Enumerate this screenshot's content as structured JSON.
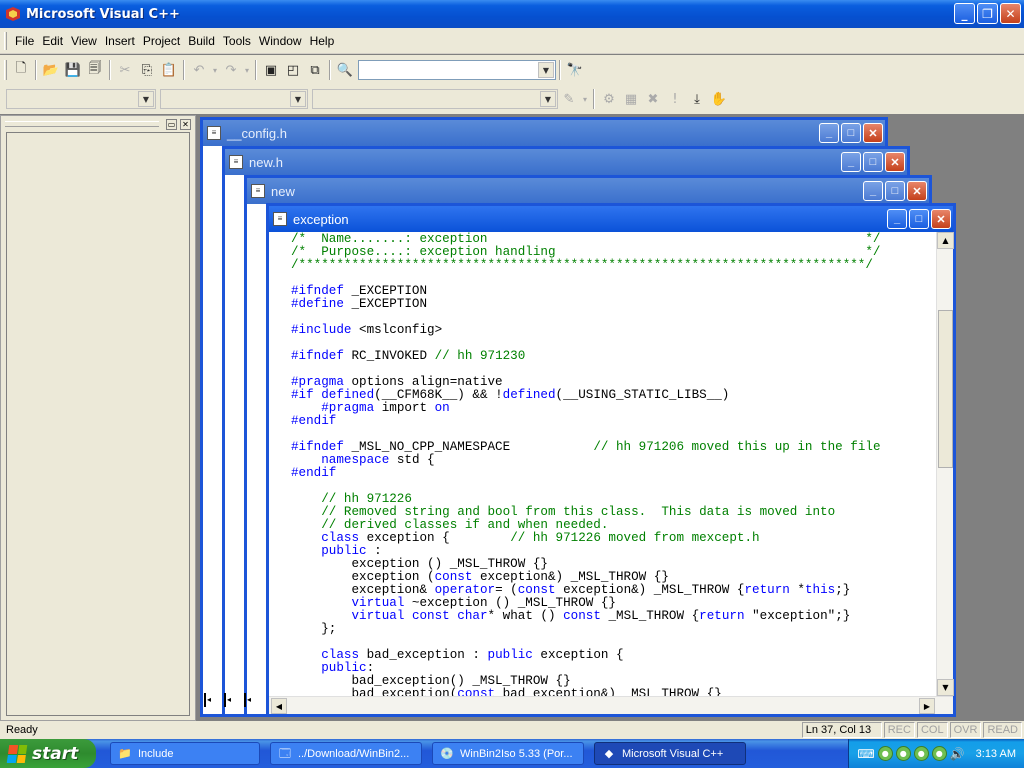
{
  "app": {
    "title": "Microsoft Visual C++"
  },
  "menu": [
    "File",
    "Edit",
    "View",
    "Insert",
    "Project",
    "Build",
    "Tools",
    "Window",
    "Help"
  ],
  "windows": [
    {
      "title": "__config.h"
    },
    {
      "title": "new.h"
    },
    {
      "title": "new"
    },
    {
      "title": "exception"
    }
  ],
  "code": [
    [
      [
        "cm",
        "/*  Name.......: exception                                                  */"
      ]
    ],
    [
      [
        "cm",
        "/*  Purpose....: exception handling                                         */"
      ]
    ],
    [
      [
        "cm",
        "/***************************************************************************/"
      ]
    ],
    [
      [
        "",
        ""
      ]
    ],
    [
      [
        "kw",
        "#ifndef"
      ],
      [
        "",
        " _EXCEPTION"
      ]
    ],
    [
      [
        "kw",
        "#define"
      ],
      [
        "",
        " _EXCEPTION"
      ]
    ],
    [
      [
        "",
        ""
      ]
    ],
    [
      [
        "kw",
        "#include"
      ],
      [
        "",
        " <mslconfig>"
      ]
    ],
    [
      [
        "",
        ""
      ]
    ],
    [
      [
        "kw",
        "#ifndef"
      ],
      [
        "",
        " RC_INVOKED "
      ],
      [
        "cm",
        "// hh 971230"
      ]
    ],
    [
      [
        "",
        ""
      ]
    ],
    [
      [
        "kw",
        "#pragma"
      ],
      [
        "",
        " options align=native"
      ]
    ],
    [
      [
        "kw",
        "#if"
      ],
      [
        "",
        " "
      ],
      [
        "kw",
        "defined"
      ],
      [
        "",
        "(__CFM68K__) && !"
      ],
      [
        "kw",
        "defined"
      ],
      [
        "",
        "(__USING_STATIC_LIBS__)"
      ]
    ],
    [
      [
        "",
        "    "
      ],
      [
        "kw",
        "#pragma"
      ],
      [
        "",
        " import "
      ],
      [
        "kw",
        "on"
      ]
    ],
    [
      [
        "kw",
        "#endif"
      ]
    ],
    [
      [
        "",
        ""
      ]
    ],
    [
      [
        "kw",
        "#ifndef"
      ],
      [
        "",
        " _MSL_NO_CPP_NAMESPACE           "
      ],
      [
        "cm",
        "// hh 971206 moved this up in the file"
      ]
    ],
    [
      [
        "",
        "    "
      ],
      [
        "kw",
        "namespace"
      ],
      [
        "",
        " std {"
      ]
    ],
    [
      [
        "kw",
        "#endif"
      ]
    ],
    [
      [
        "",
        ""
      ]
    ],
    [
      [
        "",
        "    "
      ],
      [
        "cm",
        "// hh 971226"
      ]
    ],
    [
      [
        "",
        "    "
      ],
      [
        "cm",
        "// Removed string and bool from this class.  This data is moved into"
      ]
    ],
    [
      [
        "",
        "    "
      ],
      [
        "cm",
        "// derived classes if and when needed."
      ]
    ],
    [
      [
        "",
        "    "
      ],
      [
        "kw",
        "class"
      ],
      [
        "",
        " exception {        "
      ],
      [
        "cm",
        "// hh 971226 moved from mexcept.h"
      ]
    ],
    [
      [
        "",
        "    "
      ],
      [
        "kw",
        "public"
      ],
      [
        "",
        " :"
      ]
    ],
    [
      [
        "",
        "        exception () _MSL_THROW {}"
      ]
    ],
    [
      [
        "",
        "        exception ("
      ],
      [
        "kw",
        "const"
      ],
      [
        "",
        " exception&) _MSL_THROW {}"
      ]
    ],
    [
      [
        "",
        "        exception& "
      ],
      [
        "kw",
        "operator"
      ],
      [
        "",
        "= ("
      ],
      [
        "kw",
        "const"
      ],
      [
        "",
        " exception&) _MSL_THROW {"
      ],
      [
        "kw",
        "return"
      ],
      [
        "",
        " *"
      ],
      [
        "kw",
        "this"
      ],
      [
        "",
        ";}"
      ]
    ],
    [
      [
        "",
        "        "
      ],
      [
        "kw",
        "virtual"
      ],
      [
        "",
        " ~exception () _MSL_THROW {}"
      ]
    ],
    [
      [
        "",
        "        "
      ],
      [
        "kw",
        "virtual"
      ],
      [
        "",
        " "
      ],
      [
        "kw",
        "const"
      ],
      [
        "",
        " "
      ],
      [
        "kw",
        "char"
      ],
      [
        "",
        "* what () "
      ],
      [
        "kw",
        "const"
      ],
      [
        "",
        " _MSL_THROW {"
      ],
      [
        "kw",
        "return"
      ],
      [
        "",
        " \"exception\";}"
      ]
    ],
    [
      [
        "",
        "    };"
      ]
    ],
    [
      [
        "",
        ""
      ]
    ],
    [
      [
        "",
        "    "
      ],
      [
        "kw",
        "class"
      ],
      [
        "",
        " bad_exception : "
      ],
      [
        "kw",
        "public"
      ],
      [
        "",
        " exception {"
      ]
    ],
    [
      [
        "",
        "    "
      ],
      [
        "kw",
        "public"
      ],
      [
        "",
        ":"
      ]
    ],
    [
      [
        "",
        "        bad_exception() _MSL_THROW {}"
      ]
    ],
    [
      [
        "",
        "        bad_exception("
      ],
      [
        "kw",
        "const"
      ],
      [
        "",
        " bad_exception&) _MSL_THROW {}"
      ]
    ]
  ],
  "status": {
    "ready": "Ready",
    "position": "Ln 37, Col 13",
    "rec": "REC",
    "col": "COL",
    "ovr": "OVR",
    "read": "READ"
  },
  "taskbar": {
    "start": "start",
    "tasks": [
      "Include",
      "../Download/WinBin2...",
      "WinBin2Iso 5.33 (Por...",
      "Microsoft Visual C++"
    ],
    "clock": "3:13 AM"
  }
}
